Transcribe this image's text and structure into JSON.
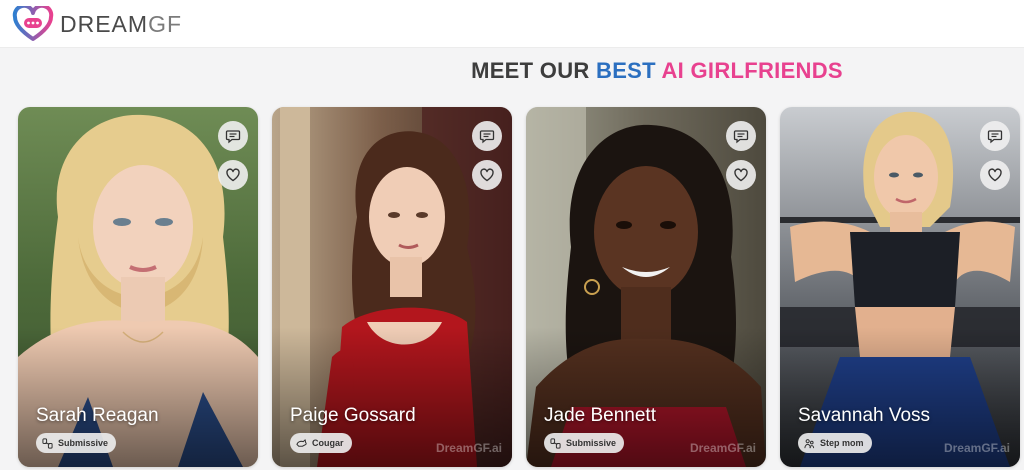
{
  "brand": {
    "name_main": "DREAM",
    "name_suffix": "GF"
  },
  "headline": {
    "part1": "MEET OUR ",
    "part2": "BEST",
    "part3": " AI GIRLFRIENDS"
  },
  "colors": {
    "blue": "#2b6fc0",
    "pink": "#e8418f",
    "dark_text": "#3d3d3d"
  },
  "cards": [
    {
      "name": "Sarah Reagan",
      "tag": "Submissive",
      "tag_icon": "chains-icon",
      "watermark": ""
    },
    {
      "name": "Paige Gossard",
      "tag": "Cougar",
      "tag_icon": "cougar-icon",
      "watermark": "DreamGF.ai"
    },
    {
      "name": "Jade Bennett",
      "tag": "Submissive",
      "tag_icon": "chains-icon",
      "watermark": "DreamGF.ai"
    },
    {
      "name": "Savannah Voss",
      "tag": "Step mom",
      "tag_icon": "family-icon",
      "watermark": "DreamGF.ai"
    }
  ],
  "card_actions": {
    "chat_icon": "chat-icon",
    "like_icon": "heart-icon"
  }
}
